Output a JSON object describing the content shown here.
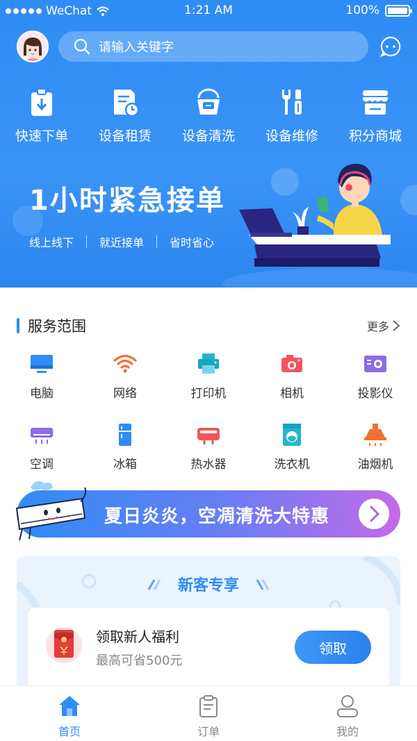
{
  "status_bar": {
    "carrier": "WeChat",
    "time": "1:21 AM",
    "battery": "100%"
  },
  "header": {
    "search_placeholder": "请输入关键字",
    "quick_actions": [
      {
        "label": "快速下单",
        "icon": "clipboard-download-icon"
      },
      {
        "label": "设备租赁",
        "icon": "document-clock-icon"
      },
      {
        "label": "设备清洗",
        "icon": "bucket-icon"
      },
      {
        "label": "设备维修",
        "icon": "tools-icon"
      },
      {
        "label": "积分商城",
        "icon": "store-icon"
      }
    ],
    "banner": {
      "title": "1小时紧急接单",
      "tags": [
        "线上线下",
        "就近接单",
        "省时省心"
      ]
    }
  },
  "services": {
    "title": "服务范围",
    "more": "更多",
    "items": [
      {
        "label": "电脑",
        "icon": "monitor-icon"
      },
      {
        "label": "网络",
        "icon": "wifi-icon"
      },
      {
        "label": "打印机",
        "icon": "printer-icon"
      },
      {
        "label": "相机",
        "icon": "camera-icon"
      },
      {
        "label": "投影仪",
        "icon": "projector-icon"
      },
      {
        "label": "空调",
        "icon": "air-conditioner-icon"
      },
      {
        "label": "冰箱",
        "icon": "fridge-icon"
      },
      {
        "label": "热水器",
        "icon": "water-heater-icon"
      },
      {
        "label": "洗衣机",
        "icon": "washing-machine-icon"
      },
      {
        "label": "油烟机",
        "icon": "range-hood-icon"
      }
    ]
  },
  "promo": {
    "text": "夏日炎炎，空凋清洗大特惠"
  },
  "new_customer": {
    "title": "新客专享",
    "offer_title": "领取新人福利",
    "offer_sub": "最高可省500元",
    "button": "领取"
  },
  "tabbar": [
    {
      "label": "首页",
      "icon": "home-icon",
      "active": true
    },
    {
      "label": "订单",
      "icon": "order-clipboard-icon",
      "active": false
    },
    {
      "label": "我的",
      "icon": "user-icon",
      "active": false
    }
  ],
  "colors": {
    "primary": "#2f8cf5",
    "promo_end": "#c46ae8"
  }
}
